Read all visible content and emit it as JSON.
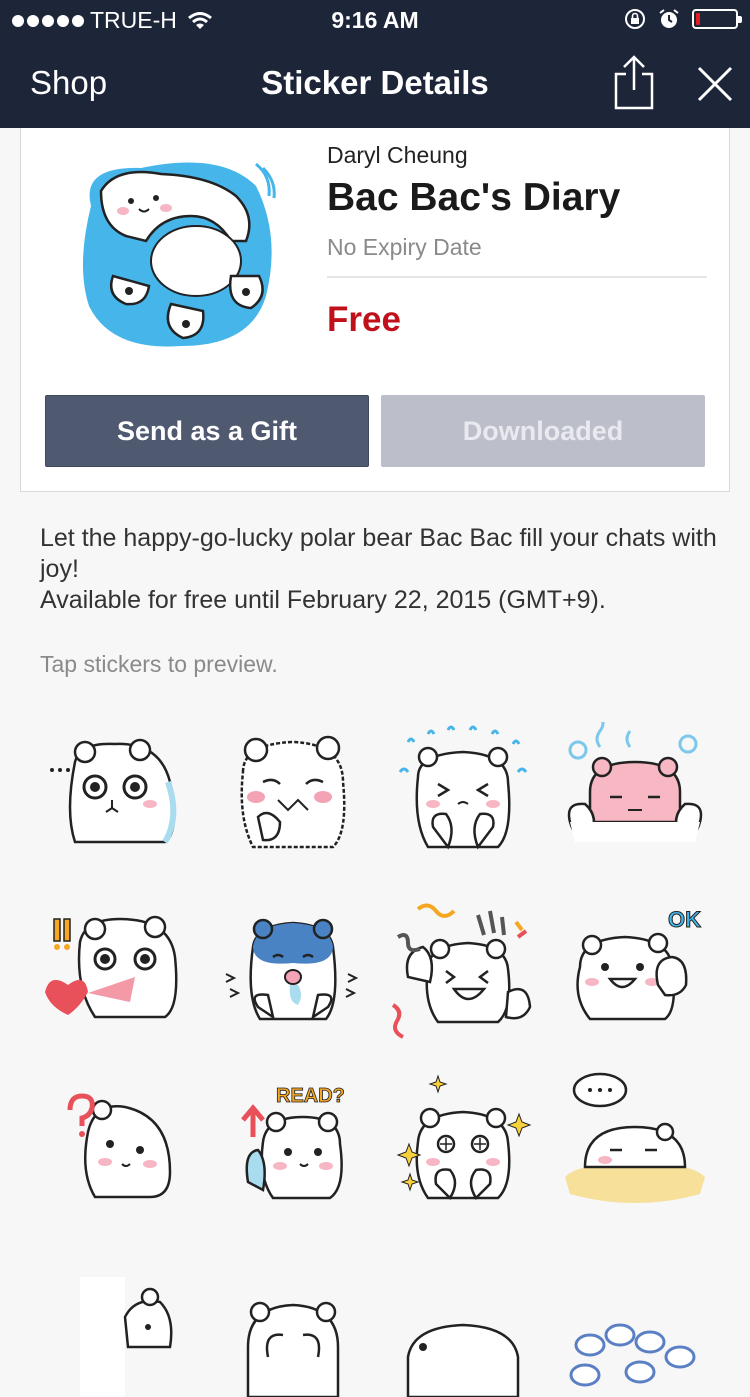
{
  "status_bar": {
    "carrier": "TRUE-H",
    "time": "9:16 AM"
  },
  "nav": {
    "back_label": "Shop",
    "title": "Sticker Details"
  },
  "pack": {
    "author": "Daryl Cheung",
    "title": "Bac Bac's Diary",
    "expiry": "No Expiry Date",
    "price": "Free",
    "gift_button": "Send as a Gift",
    "downloaded_button": "Downloaded"
  },
  "description": {
    "line1": "Let the happy-go-lucky polar bear Bac Bac fill your chats with joy!",
    "line2": "Available for free until February 22, 2015 (GMT+9)."
  },
  "hint": "Tap stickers to preview.",
  "stickers": [
    {
      "name": "sticker-shocked"
    },
    {
      "name": "sticker-worried"
    },
    {
      "name": "sticker-crying"
    },
    {
      "name": "sticker-sweating-pink"
    },
    {
      "name": "sticker-love-shout"
    },
    {
      "name": "sticker-drooling-blue"
    },
    {
      "name": "sticker-party"
    },
    {
      "name": "sticker-ok"
    },
    {
      "name": "sticker-question"
    },
    {
      "name": "sticker-read",
      "text": "READ?"
    },
    {
      "name": "sticker-sparkle"
    },
    {
      "name": "sticker-sleepy"
    },
    {
      "name": "sticker-peek"
    },
    {
      "name": "sticker-cover-face"
    },
    {
      "name": "sticker-lying"
    },
    {
      "name": "sticker-speech-bubbles"
    }
  ]
}
